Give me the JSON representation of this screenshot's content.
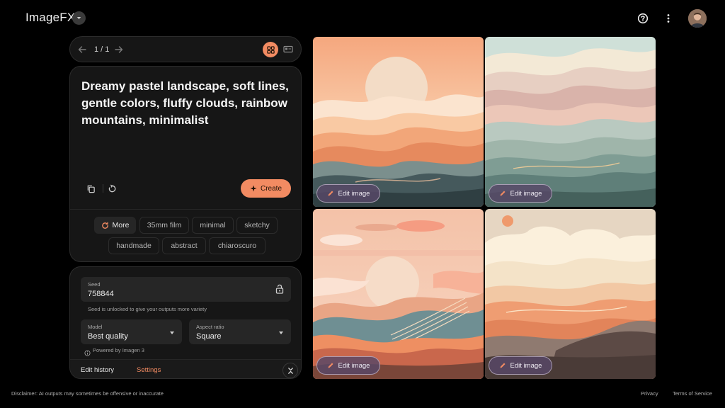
{
  "app": {
    "title": "ImageFX"
  },
  "nav": {
    "counter": "1 / 1"
  },
  "prompt": {
    "text": "Dreamy pastel landscape, soft lines, gentle colors, fluffy clouds, rainbow mountains, minimalist",
    "create_label": "Create"
  },
  "chips": [
    "More",
    "35mm film",
    "minimal",
    "sketchy",
    "handmade",
    "abstract",
    "chiaroscuro"
  ],
  "settings": {
    "seed_label": "Seed",
    "seed_value": "758844",
    "seed_hint": "Seed is unlocked to give your outputs more variety",
    "model_label": "Model",
    "model_value": "Best quality",
    "aspect_label": "Aspect ratio",
    "aspect_value": "Square",
    "powered_by": "Powered by Imagen 3"
  },
  "tabs": {
    "edit_history": "Edit history",
    "settings": "Settings"
  },
  "images": {
    "edit_label": "Edit image"
  },
  "footer": {
    "disclaimer": "Disclaimer: AI outputs may sometimes be offensive or inaccurate",
    "privacy": "Privacy",
    "terms": "Terms of Service"
  },
  "colors": {
    "accent": "#f28b62",
    "surface": "#161616",
    "field": "#262626",
    "background": "#000000"
  },
  "icons": [
    "chevron-down-icon",
    "help-icon",
    "more-vert-icon",
    "arrow-left-icon",
    "arrow-right-icon",
    "grid-view-icon",
    "single-view-icon",
    "copy-icon",
    "reset-icon",
    "sparkle-icon",
    "refresh-icon",
    "unlock-icon",
    "info-icon",
    "collapse-icon",
    "pencil-icon"
  ]
}
